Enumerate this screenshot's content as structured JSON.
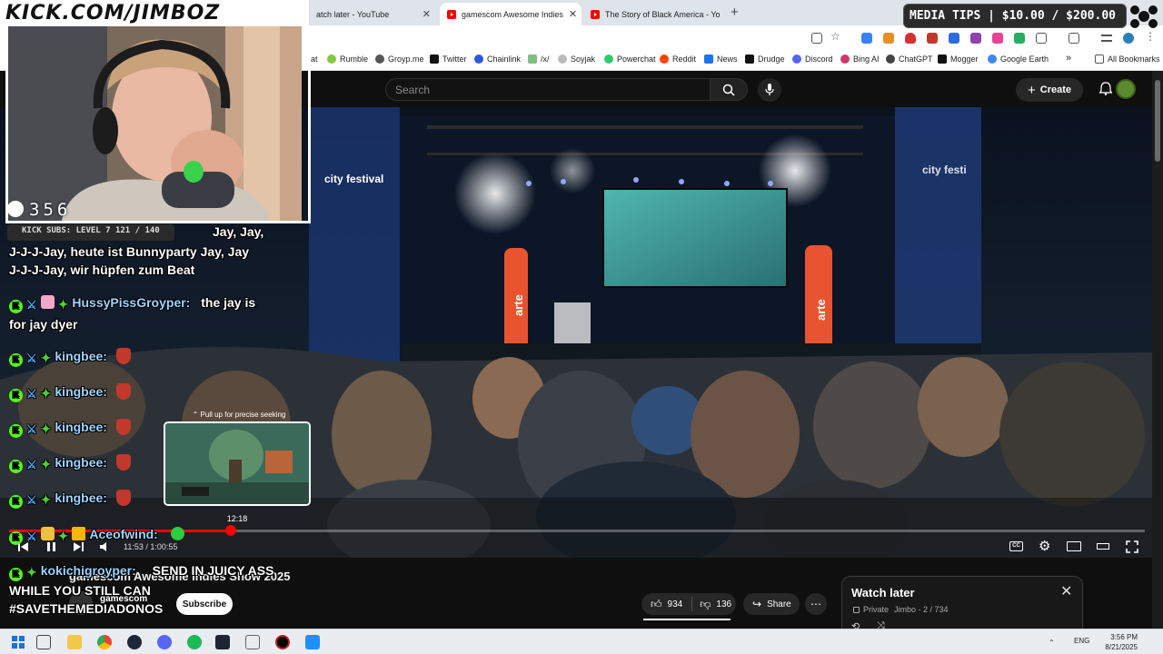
{
  "browser": {
    "tabs": [
      {
        "title": "atch later - YouTube",
        "active": false
      },
      {
        "title": "gamescom Awesome Indies",
        "active": true
      },
      {
        "title": "The Story of Black America - Yo",
        "active": false
      }
    ],
    "bookmarks": [
      "at",
      "Rumble",
      "Groyp.me",
      "Twitter",
      "Chainlink",
      "/x/",
      "Soyjak",
      "Powerchat",
      "Reddit",
      "News",
      "Drudge",
      "Discord",
      "Bing AI",
      "ChatGPT",
      "Mogger",
      "Google Earth"
    ],
    "all_bookmarks": "All Bookmarks",
    "more": "»"
  },
  "overlay": {
    "banner": "KICK.COM/JIMBOZ",
    "viewer_count": "356",
    "kick_subs": "KICK SUBS: LEVEL 7 121 / 140",
    "media_tips": "MEDIA TIPS | $10.00 / $200.00"
  },
  "chat": [
    {
      "text": "Jay, Jay,"
    },
    {
      "text": "J-J-J-Jay, heute ist Bunnyparty Jay, Jay"
    },
    {
      "text": "J-J-J-Jay, wir hüpfen zum Beat"
    },
    {
      "user": "HussyPissGroyper:",
      "msg": "the jay is"
    },
    {
      "text": "for jay dyer"
    },
    {
      "user": "kingbee:"
    },
    {
      "user": "kingbee:"
    },
    {
      "user": "kingbee:"
    },
    {
      "user": "kingbee:"
    },
    {
      "user": "kingbee:"
    },
    {
      "user": "Aceofwind:"
    },
    {
      "user": "kokichigroyper:",
      "msg": "SEND IN JUICY ASS"
    },
    {
      "text": "WHILE YOU STILL CAN"
    },
    {
      "text": "#SAVETHEMEDIADONOS"
    }
  ],
  "youtube": {
    "search_placeholder": "Search",
    "create": "Create",
    "video": {
      "title": "gamescom Awesome Indies Show 2025",
      "channel": "gamescom",
      "subscribe": "Subscribe",
      "likes": "934",
      "dislikes": "136",
      "share": "Share",
      "more": "⋯",
      "time_current": "11:53",
      "time_total": "1:00:55",
      "timecode": "11:53 / 1:00:55",
      "preview_hint": "⌃ Pull up for precise seeking",
      "preview_time": "12:18",
      "progress": 0.195,
      "stage_text_left": "city festival",
      "stage_text_right": "city festi",
      "banner_brand": "arte"
    },
    "watch_later": {
      "title": "Watch later",
      "privacy": "Private",
      "meta": "Jimbo - 2 / 734"
    }
  },
  "taskbar": {
    "lang": "ENG",
    "time": "3:56 PM",
    "date": "8/21/2025"
  },
  "colors": {
    "accent": "#ff0000",
    "kick_green": "#53fc18",
    "chat_user": "#9fd3ff"
  }
}
